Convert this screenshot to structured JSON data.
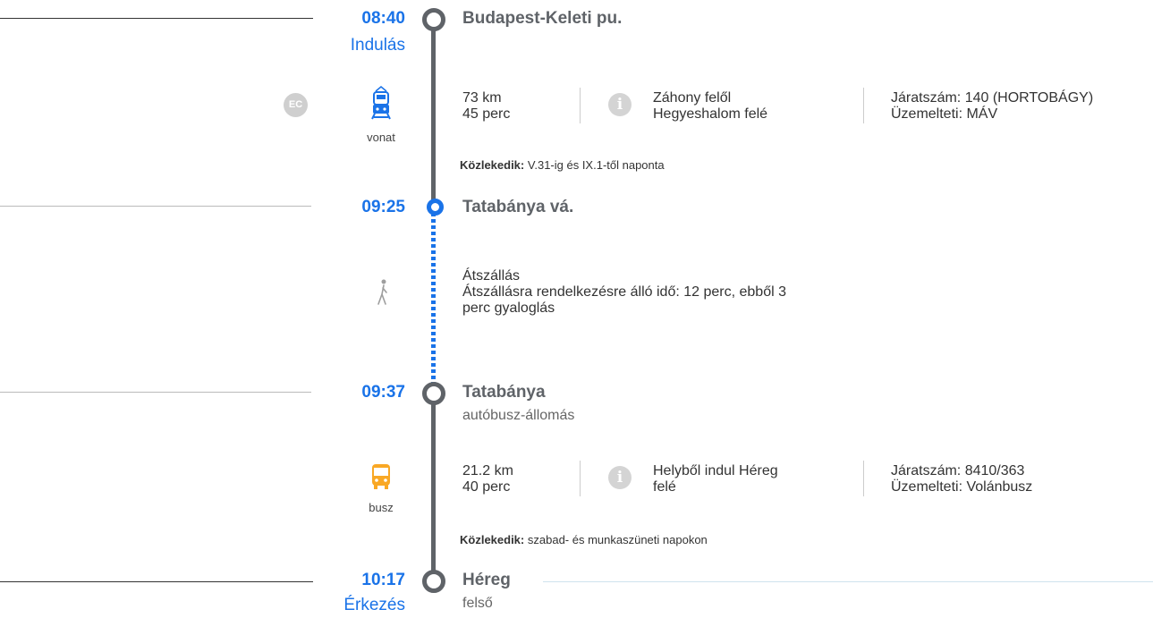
{
  "stops": [
    {
      "time": "08:40",
      "label": "Indulás",
      "name": "Budapest-Keleti pu.",
      "sub": ""
    },
    {
      "time": "09:25",
      "label": "",
      "name": "Tatabánya vá.",
      "sub": ""
    },
    {
      "time": "09:37",
      "label": "",
      "name": "Tatabánya",
      "sub": "autóbusz-állomás"
    },
    {
      "time": "10:17",
      "label": "Érkezés",
      "name": "Héreg",
      "sub": "felső"
    }
  ],
  "legs": [
    {
      "badge": "EC",
      "mode_icon": "train-icon",
      "mode_label": "vonat",
      "distance": "73 km",
      "duration": "45 perc",
      "dir_line1": "Záhony felől",
      "dir_line2": "Hegyeshalom felé",
      "number": "Járatszám: 140 (HORTOBÁGY)",
      "operator": "Üzemelteti: MÁV",
      "note_label": "Közlekedik:",
      "note_text": "V.31-ig és IX.1-től naponta",
      "color": "#1a73e8"
    },
    {
      "mode_icon": "walk-icon",
      "title": "Átszállás",
      "line1": "Átszállásra rendelkezésre álló idő: 12 perc, ebből 3",
      "line2": "perc gyaloglás"
    },
    {
      "mode_icon": "bus-icon",
      "mode_label": "busz",
      "distance": "21.2 km",
      "duration": "40 perc",
      "dir_line1": "Helyből indul Héreg",
      "dir_line2": "felé",
      "number": "Járatszám: 8410/363",
      "operator": "Üzemelteti: Volánbusz",
      "note_label": "Közlekedik:",
      "note_text": "szabad- és munkaszüneti napokon",
      "color": "#f9a825"
    }
  ],
  "info_glyph": "i",
  "colors": {
    "accent": "#1a73e8",
    "line": "#5f6368",
    "bus": "#f9a825"
  }
}
